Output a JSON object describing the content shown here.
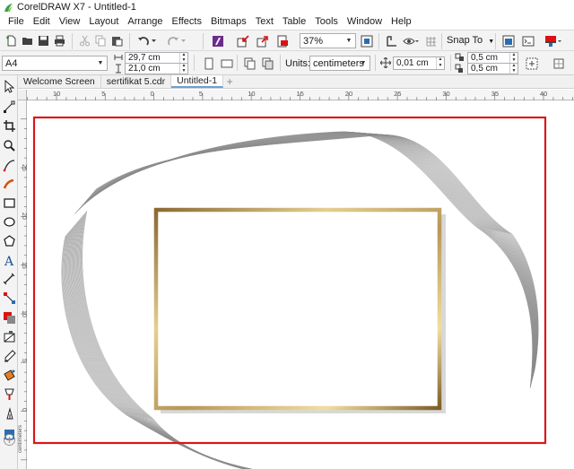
{
  "window": {
    "title": "CorelDRAW X7 - Untitled-1"
  },
  "menu": [
    "File",
    "Edit",
    "View",
    "Layout",
    "Arrange",
    "Effects",
    "Bitmaps",
    "Text",
    "Table",
    "Tools",
    "Window",
    "Help"
  ],
  "toolbar": {
    "zoom": "37%",
    "snap_to": "Snap To"
  },
  "properties": {
    "page_size": "A4",
    "width": "29,7 cm",
    "height": "21,0 cm",
    "units_label": "Units:",
    "units_value": "centimeters",
    "nudge": "0,01 cm",
    "dup_x": "0,5 cm",
    "dup_y": "0,5 cm"
  },
  "tabs": [
    "Welcome Screen",
    "sertifikat 5.cdr",
    "Untitled-1"
  ],
  "active_tab_index": 2,
  "rulers": {
    "horizontal": [
      "10",
      "5",
      "0",
      "5",
      "10",
      "15",
      "20",
      "25",
      "30",
      "35",
      "40"
    ],
    "vertical": [
      "25",
      "20",
      "15",
      "10",
      "5",
      "0"
    ],
    "units_text": "centimeters"
  },
  "colors": {
    "page_border": "#d9181a",
    "frame_gold": "#b8975a",
    "wave_lines": "#8a8a8a",
    "active_tab_accent": "#6aa0d8"
  },
  "icons": {
    "toolbar": [
      "new-icon",
      "open-icon",
      "save-icon",
      "print-icon",
      "cut-icon",
      "copy-icon",
      "paste-icon",
      "undo-icon",
      "redo-icon",
      "corel-connect-icon",
      "import-icon",
      "export-icon",
      "publish-pdf-icon",
      "zoom-level-icon",
      "full-screen-icon",
      "show-rulers-icon",
      "show-grid-icon",
      "options-icon",
      "launch-icon"
    ],
    "toolbox": [
      "pick-tool-icon",
      "shape-tool-icon",
      "crop-tool-icon",
      "zoom-tool-icon",
      "freehand-tool-icon",
      "artistic-media-icon",
      "rectangle-tool-icon",
      "ellipse-tool-icon",
      "polygon-tool-icon",
      "text-tool-icon",
      "parallel-dimension-icon",
      "connector-tool-icon",
      "drop-shadow-icon",
      "transparency-icon",
      "eyedropper-icon",
      "interactive-fill-icon",
      "smart-fill-icon",
      "outline-pen-icon",
      "color-eyedropper-icon",
      "add-tool-icon"
    ]
  }
}
